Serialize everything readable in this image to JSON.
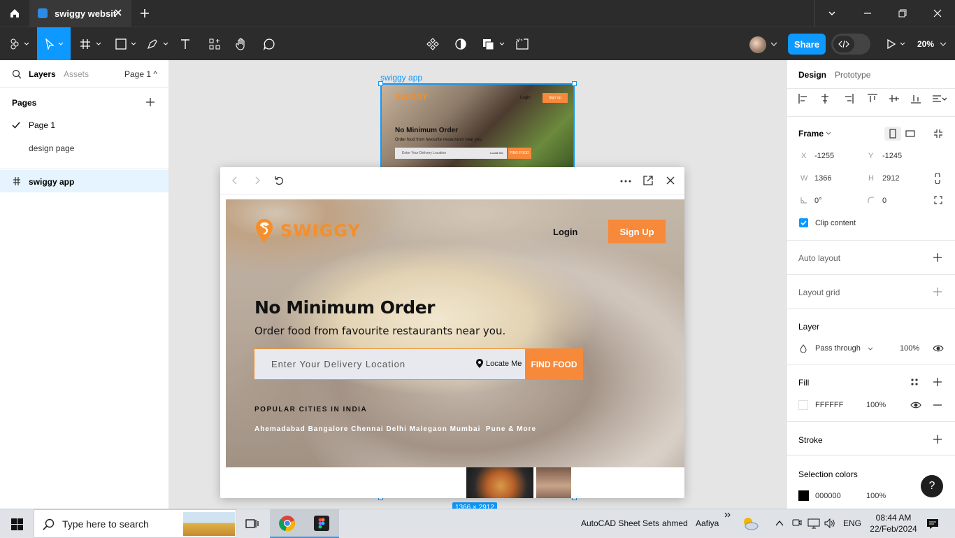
{
  "titlebar": {
    "tab_title": "swiggy websit"
  },
  "toolbar": {
    "share_label": "Share",
    "zoom": "20%"
  },
  "left_panel": {
    "tabs": [
      "Layers",
      "Assets"
    ],
    "page_selector": "Page 1 ^",
    "pages_title": "Pages",
    "pages": [
      "Page 1",
      "design page"
    ],
    "layers": [
      "swiggy app"
    ]
  },
  "canvas": {
    "frame_label": "swiggy app",
    "frame_dims": "1366 × 2912",
    "thumb": {
      "logo": "SWIGGY",
      "login": "Login",
      "signup": "Sign Up",
      "heading": "No Minimum Order",
      "sub": "Order food from favourite restaurants near you.",
      "input": "Enter Your Delivery Location",
      "locate": "Locate Me",
      "find": "FIND FOOD"
    }
  },
  "preview": {
    "logo": "SWIGGY",
    "login": "Login",
    "signup": "Sign Up",
    "heading": "No Minimum Order",
    "subheading": "Order food from favourite restaurants near you.",
    "input_placeholder": "Enter Your Delivery Location",
    "locate": "Locate Me",
    "find_button": "FIND FOOD",
    "popular_title": "POPULAR CITIES IN INDIA",
    "cities": "Ahemadabad Bangalore Chennai Delhi Malegaon Mumbai  Pune & More"
  },
  "right_panel": {
    "tabs": [
      "Design",
      "Prototype"
    ],
    "frame_label": "Frame",
    "x_label": "X",
    "x": "-1255",
    "y_label": "Y",
    "y": "-1245",
    "w_label": "W",
    "w": "1366",
    "h_label": "H",
    "h": "2912",
    "rotation": "0°",
    "radius": "0",
    "clip_content": "Clip content",
    "auto_layout": "Auto layout",
    "layout_grid": "Layout grid",
    "layer_title": "Layer",
    "blend_mode": "Pass through",
    "layer_opacity": "100%",
    "fill_title": "Fill",
    "fill_hex": "FFFFFF",
    "fill_opacity": "100%",
    "stroke_title": "Stroke",
    "selection_colors_title": "Selection colors",
    "sel_hex": "000000",
    "sel_opacity": "100%"
  },
  "taskbar": {
    "search_placeholder": "Type here to search",
    "items": [
      "AutoCAD Sheet Sets",
      "ahmed",
      "Aafiya"
    ],
    "lang": "ENG",
    "time": "08:44 AM",
    "date": "22/Feb/2024"
  },
  "colors": {
    "accent": "#0d99ff",
    "swiggy_orange": "#f7893a",
    "dark_ui": "#2c2c2c"
  }
}
